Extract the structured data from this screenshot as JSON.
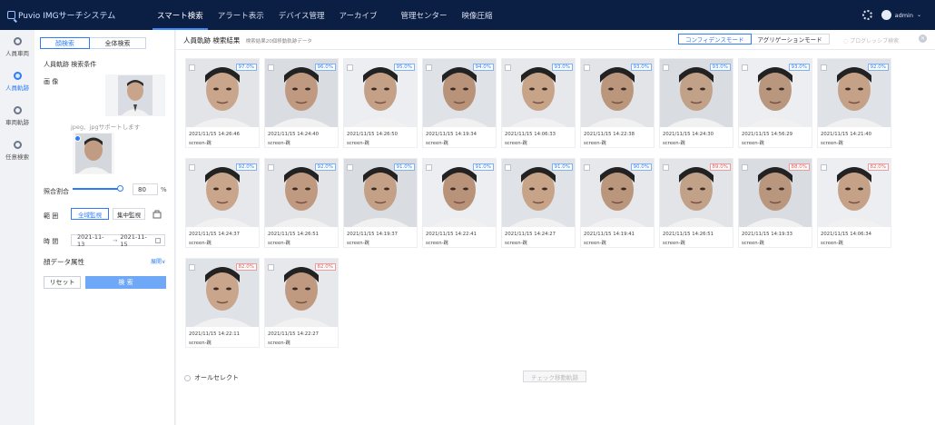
{
  "app": {
    "title": "Puvio IMGサーチシステム"
  },
  "nav": {
    "items": [
      {
        "label": "スマート検索",
        "active": true
      },
      {
        "label": "アラート表示",
        "active": false
      },
      {
        "label": "デバイス管理",
        "active": false
      },
      {
        "label": "アーカイブ",
        "active": false
      },
      {
        "label": "管理センター",
        "active": false
      },
      {
        "label": "映像圧縮",
        "active": false
      }
    ]
  },
  "header": {
    "user": "admin",
    "settings_icon": "gear-icon"
  },
  "rail": {
    "items": [
      {
        "label": "人員車両",
        "icon": "search-icon",
        "active": false
      },
      {
        "label": "人員軌跡",
        "icon": "search-icon",
        "active": true
      },
      {
        "label": "車両軌跡",
        "icon": "search-icon",
        "active": false
      },
      {
        "label": "任意検索",
        "icon": "search-icon",
        "active": false
      }
    ]
  },
  "panel": {
    "seg": {
      "left": "顔検索",
      "right": "全体検索"
    },
    "heading": "人員軌跡 検索条件",
    "image_label": "画 像",
    "hint": "jpeg、jpgサポートします",
    "threshold_label": "照合割合",
    "threshold_value": "80",
    "threshold_unit": "%",
    "threshold_fraction": 0.8,
    "range_label": "範 囲",
    "range_all": "全域監視",
    "range_focus": "集中監視",
    "time_label": "時 間",
    "date_from": "2021-11-13",
    "date_arrow": "→",
    "date_to": "2021-11-15",
    "attr_label": "顔データ属性",
    "expand": "展開∨",
    "reset": "リセット",
    "search": "検 索"
  },
  "main": {
    "title": "人員軌跡 検索結果",
    "subtitle": "検索結果20個移動軌跡データ",
    "mode_confidence": "コンフィデンスモード",
    "mode_aggregation": "アグリゲーションモード",
    "progressive": "プログレッシブ検索",
    "select_all": "オールセレクト",
    "check_track": "チェック移動軌跡",
    "results": [
      {
        "score": "97.0%",
        "time": "2021/11/15 14:26:46",
        "loc": "screen-跳",
        "low": false
      },
      {
        "score": "96.0%",
        "time": "2021/11/15 14:24:40",
        "loc": "screen-跳",
        "low": false
      },
      {
        "score": "95.0%",
        "time": "2021/11/15 14:26:50",
        "loc": "screen-跳",
        "low": false
      },
      {
        "score": "94.0%",
        "time": "2021/11/15 14:19:34",
        "loc": "screen-跳",
        "low": false
      },
      {
        "score": "93.0%",
        "time": "2021/11/15 14:06:33",
        "loc": "screen-跳",
        "low": false
      },
      {
        "score": "93.0%",
        "time": "2021/11/15 14:22:38",
        "loc": "screen-跳",
        "low": false
      },
      {
        "score": "93.0%",
        "time": "2021/11/15 14:24:30",
        "loc": "screen-跳",
        "low": false
      },
      {
        "score": "93.0%",
        "time": "2021/11/15 14:56:29",
        "loc": "screen-跳",
        "low": false
      },
      {
        "score": "92.0%",
        "time": "2021/11/15 14:21:40",
        "loc": "screen-跳",
        "low": false
      },
      {
        "score": "92.0%",
        "time": "2021/11/15 14:24:37",
        "loc": "screen-跳",
        "low": false
      },
      {
        "score": "92.0%",
        "time": "2021/11/15 14:26:51",
        "loc": "screen-跳",
        "low": false
      },
      {
        "score": "91.0%",
        "time": "2021/11/15 14:19:37",
        "loc": "screen-跳",
        "low": false
      },
      {
        "score": "91.0%",
        "time": "2021/11/15 14:22:41",
        "loc": "screen-跳",
        "low": false
      },
      {
        "score": "91.0%",
        "time": "2021/11/15 14:24:27",
        "loc": "screen-跳",
        "low": false
      },
      {
        "score": "90.0%",
        "time": "2021/11/15 14:19:41",
        "loc": "screen-跳",
        "low": false
      },
      {
        "score": "89.0%",
        "time": "2021/11/15 14:26:51",
        "loc": "screen-跳",
        "low": true
      },
      {
        "score": "88.0%",
        "time": "2021/11/15 14:19:33",
        "loc": "screen-跳",
        "low": true
      },
      {
        "score": "82.0%",
        "time": "2021/11/15 14:06:34",
        "loc": "screen-跳",
        "low": true
      },
      {
        "score": "82.0%",
        "time": "2021/11/15 14:22:11",
        "loc": "screen-跳",
        "low": true
      },
      {
        "score": "82.0%",
        "time": "2021/11/15 14:22:27",
        "loc": "screen-跳",
        "low": true
      }
    ]
  },
  "colors": {
    "nav_bg": "#0b1f45",
    "accent": "#2f7cf6",
    "low_score": "#e05a5a"
  }
}
